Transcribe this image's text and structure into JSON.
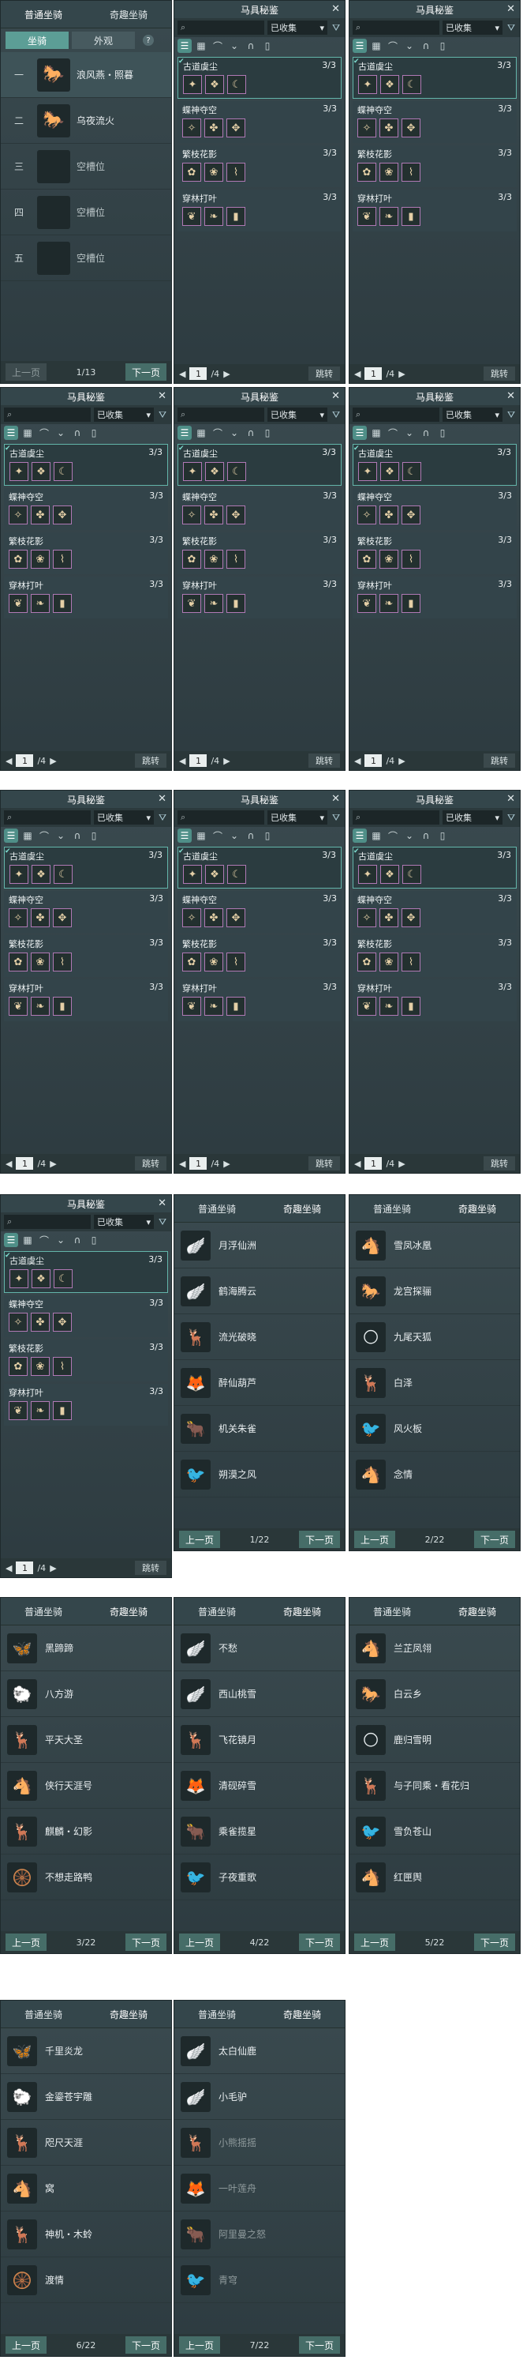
{
  "mount_tabs": {
    "normal": "普通坐骑",
    "fun": "奇趣坐骑"
  },
  "mount_subtabs": {
    "mount": "坐骑",
    "appearance": "外观",
    "help": "?"
  },
  "pager": {
    "prev": "上一页",
    "next": "下一页"
  },
  "slots_page": {
    "page": "1/13",
    "slots": [
      {
        "num": "一",
        "label": "浪风燕・照暮",
        "icon": "🐎"
      },
      {
        "num": "二",
        "label": "乌夜流火",
        "icon": "🐎"
      },
      {
        "num": "三",
        "label": "空槽位",
        "icon": ""
      },
      {
        "num": "四",
        "label": "空槽位",
        "icon": ""
      },
      {
        "num": "五",
        "label": "空槽位",
        "icon": ""
      }
    ]
  },
  "armor": {
    "title": "马具秘鉴",
    "filter": "已收集",
    "page_total": "/4",
    "page_input": "1",
    "jump": "跳转",
    "sets": [
      {
        "name": "古道虞尘",
        "count": "3/3",
        "pieces": [
          "✦",
          "❖",
          "☾"
        ]
      },
      {
        "name": "蝶神夺空",
        "count": "3/3",
        "pieces": [
          "✧",
          "✤",
          "✥"
        ]
      },
      {
        "name": "繁枝花影",
        "count": "3/3",
        "pieces": [
          "✿",
          "❀",
          "⌇"
        ]
      },
      {
        "name": "穿林打叶",
        "count": "3/3",
        "pieces": [
          "❦",
          "❧",
          "▮"
        ]
      }
    ]
  },
  "fun_pages": [
    {
      "page": "1/22",
      "items": [
        "月浮仙洲",
        "鹤海腾云",
        "流光破晓",
        "醉仙葫芦",
        "机关朱雀",
        "朔漠之风"
      ]
    },
    {
      "page": "2/22",
      "items": [
        "雪凤冰凰",
        "龙宫探骊",
        "九尾天狐",
        "白泽",
        "风火板",
        "念情"
      ]
    },
    {
      "page": "3/22",
      "items": [
        "黑蹄蹄",
        "八方游",
        "平天大圣",
        "侠行天涯号",
        "麒麟・幻影",
        "不想走路鸭"
      ]
    },
    {
      "page": "4/22",
      "items": [
        "不愁",
        "西山桃雪",
        "飞花镜月",
        "清砚碎雪",
        "乘雀揽星",
        "子夜重歌"
      ]
    },
    {
      "page": "5/22",
      "items": [
        "兰芷凤翎",
        "白云乡",
        "鹿归雪明",
        "与子同乘・看花归",
        "雪负苍山",
        "红匣舆"
      ]
    },
    {
      "page": "6/22",
      "items": [
        "千里炎龙",
        "金鎏苍宇雕",
        "咫尺天涯",
        "窝",
        "神机・木蛉",
        "渡情"
      ]
    },
    {
      "page": "7/22",
      "items": [
        "太白仙鹿",
        "小毛驴",
        "小熊摇摇",
        "一叶莲舟",
        "阿里曼之怒",
        "青穹"
      ]
    }
  ]
}
